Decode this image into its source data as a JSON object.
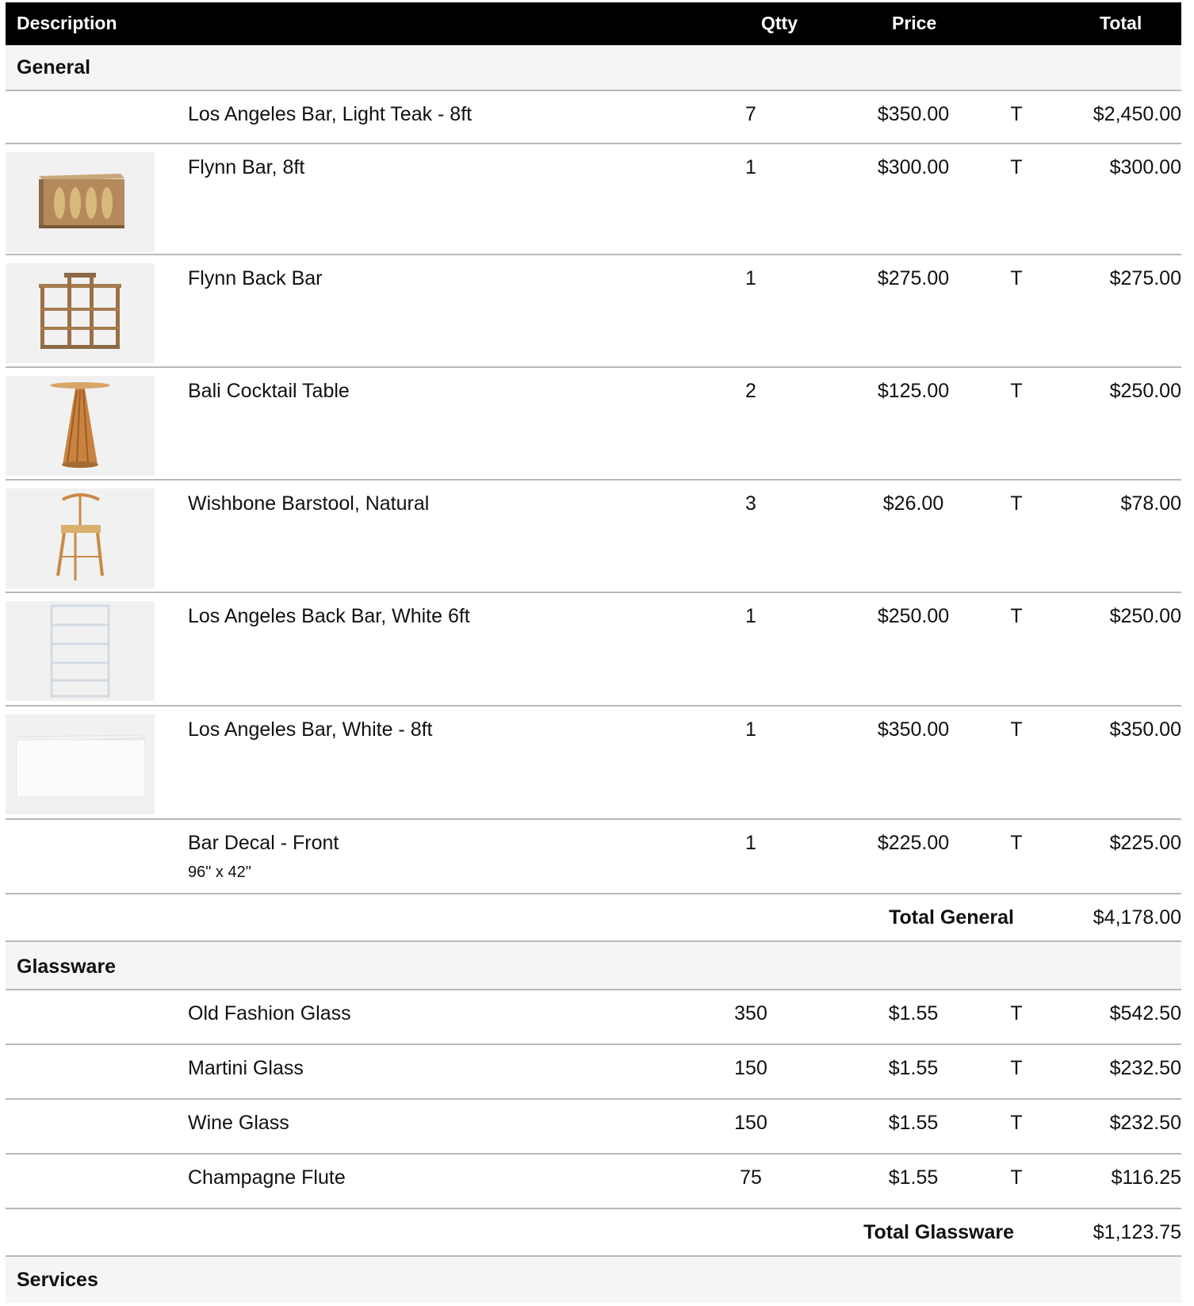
{
  "header": {
    "description": "Description",
    "qty": "Qtty",
    "price": "Price",
    "total": "Total"
  },
  "general": {
    "title": "General",
    "items": [
      {
        "description": "Los Angeles Bar, Light Teak - 8ft",
        "qty": "7",
        "price": "$350.00",
        "tax": "T",
        "total": "$2,450.00"
      },
      {
        "description": "Flynn Bar, 8ft",
        "qty": "1",
        "price": "$300.00",
        "tax": "T",
        "total": "$300.00"
      },
      {
        "description": "Flynn Back Bar",
        "qty": "1",
        "price": "$275.00",
        "tax": "T",
        "total": "$275.00"
      },
      {
        "description": "Bali Cocktail Table",
        "qty": "2",
        "price": "$125.00",
        "tax": "T",
        "total": "$250.00"
      },
      {
        "description": "Wishbone Barstool, Natural",
        "qty": "3",
        "price": "$26.00",
        "tax": "T",
        "total": "$78.00"
      },
      {
        "description": "Los Angeles Back Bar, White 6ft",
        "qty": "1",
        "price": "$250.00",
        "tax": "T",
        "total": "$250.00"
      },
      {
        "description": "Los Angeles Bar, White - 8ft",
        "qty": "1",
        "price": "$350.00",
        "tax": "T",
        "total": "$350.00"
      },
      {
        "description": "Bar Decal - Front",
        "note": "96\" x 42\"",
        "qty": "1",
        "price": "$225.00",
        "tax": "T",
        "total": "$225.00"
      }
    ],
    "total_label": "Total General",
    "total_value": "$4,178.00"
  },
  "glassware": {
    "title": "Glassware",
    "items": [
      {
        "description": "Old Fashion Glass",
        "qty": "350",
        "price": "$1.55",
        "tax": "T",
        "total": "$542.50"
      },
      {
        "description": "Martini Glass",
        "qty": "150",
        "price": "$1.55",
        "tax": "T",
        "total": "$232.50"
      },
      {
        "description": "Wine Glass",
        "qty": "150",
        "price": "$1.55",
        "tax": "T",
        "total": "$232.50"
      },
      {
        "description": "Champagne Flute",
        "qty": "75",
        "price": "$1.55",
        "tax": "T",
        "total": "$116.25"
      }
    ],
    "total_label": "Total Glassware",
    "total_value": "$1,123.75"
  },
  "services": {
    "title": "Services"
  }
}
